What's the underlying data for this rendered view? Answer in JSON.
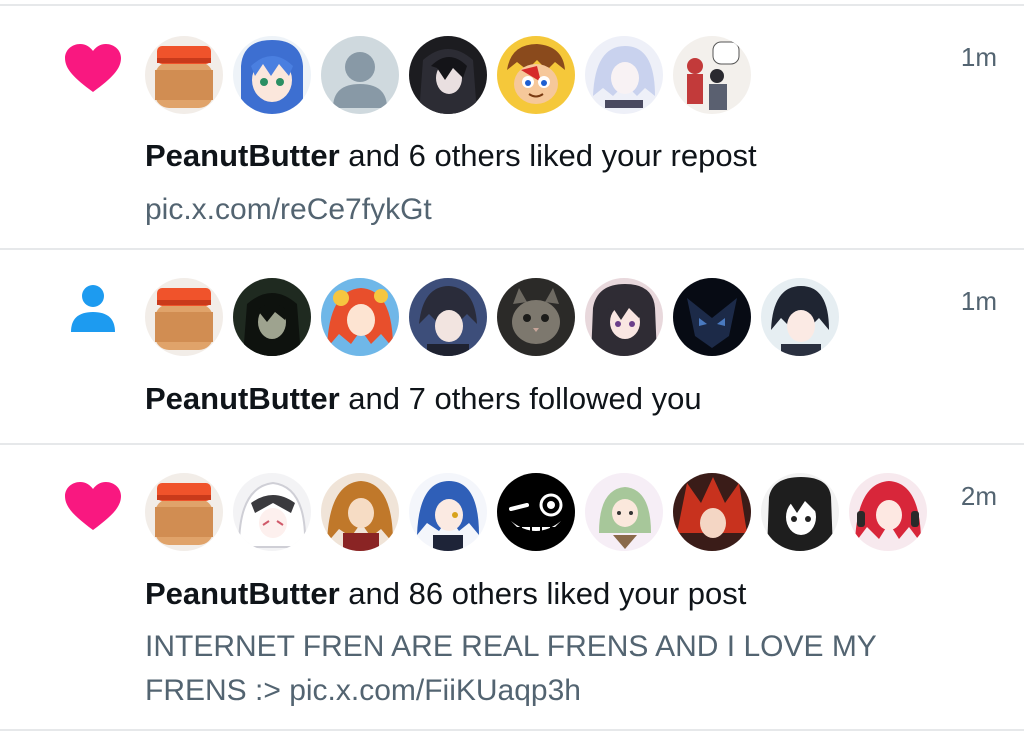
{
  "notifications": [
    {
      "type": "like",
      "icon": "heart-icon",
      "icon_color": "#f91880",
      "time": "1m",
      "actor": "PeanutButter",
      "summary_rest": "and 6 others liked your repost",
      "preview": "pic.x.com/reCe7fykGt",
      "avatars": [
        "peanut-butter-jar",
        "blue-hair-anime",
        "default-profile",
        "dark-hair-anime",
        "cartoon-boy",
        "white-hair-anime",
        "manga-couple"
      ]
    },
    {
      "type": "follow",
      "icon": "person-icon",
      "icon_color": "#1d9bf0",
      "time": "1m",
      "actor": "PeanutButter",
      "summary_rest": "and 7 others followed you",
      "preview": "",
      "avatars": [
        "peanut-butter-jar",
        "dark-anime-girl",
        "red-hair-anime",
        "suit-anime",
        "cat-photo",
        "twin-tail-anime",
        "dark-mecha",
        "dark-hair-boy"
      ]
    },
    {
      "type": "like",
      "icon": "heart-icon",
      "icon_color": "#f91880",
      "time": "2m",
      "actor": "PeanutButter",
      "summary_rest": "and 86 others liked your post",
      "preview": "INTERNET FREN ARE REAL FRENS AND I LOVE  MY FRENS :> pic.x.com/FiiKUaqp3h",
      "avatars": [
        "peanut-butter-jar",
        "white-hood-anime",
        "ginger-anime",
        "blue-hair-girl",
        "wink-smiley",
        "green-hood-anime",
        "red-hair-fire",
        "manga-girl",
        "red-hair-headphones"
      ]
    }
  ],
  "colors": {
    "like": "#f91880",
    "follow": "#1d9bf0",
    "secondary_text": "#536471",
    "primary_text": "#0f1419",
    "divider": "#e6e8ea"
  }
}
